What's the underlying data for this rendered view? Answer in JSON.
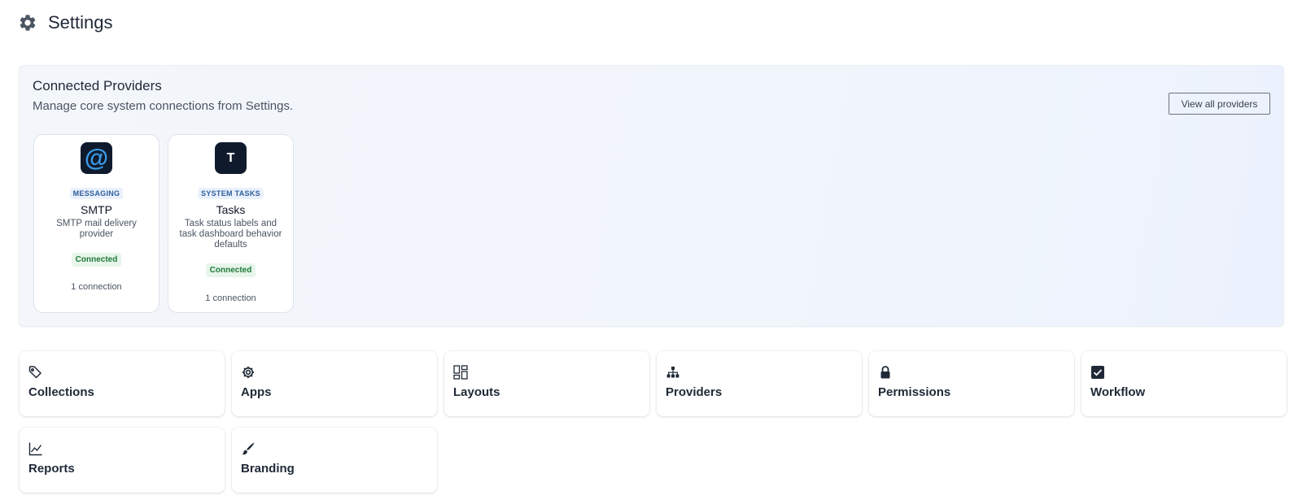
{
  "header": {
    "title": "Settings",
    "icon": "gear-icon"
  },
  "providers": {
    "title": "Connected Providers",
    "subtitle": "Manage core system connections from Settings.",
    "view_all_label": "View all providers",
    "cards": [
      {
        "icon_glyph": "@",
        "icon": "at-sign-icon",
        "category": "MESSAGING",
        "name": "SMTP",
        "description": "SMTP mail delivery provider",
        "status": "Connected",
        "connections": "1 connection"
      },
      {
        "icon_glyph": "T",
        "icon": "letter-t-icon",
        "category": "SYSTEM TASKS",
        "name": "Tasks",
        "description": "Task status labels and task dashboard behavior defaults",
        "status": "Connected",
        "connections": "1 connection"
      }
    ]
  },
  "tiles": [
    {
      "label": "Collections",
      "icon": "tag-icon"
    },
    {
      "label": "Apps",
      "icon": "gear-icon"
    },
    {
      "label": "Layouts",
      "icon": "layout-grid-icon"
    },
    {
      "label": "Providers",
      "icon": "hierarchy-icon"
    },
    {
      "label": "Permissions",
      "icon": "lock-icon"
    },
    {
      "label": "Workflow",
      "icon": "checkbox-icon"
    },
    {
      "label": "Reports",
      "icon": "line-chart-icon"
    },
    {
      "label": "Branding",
      "icon": "brush-icon"
    }
  ],
  "colors": {
    "accent": "#3b9ce8",
    "icon_bg": "#0f1b2d",
    "status_green": "#1f7a3a",
    "panel_bg": "#f1f5fc"
  }
}
